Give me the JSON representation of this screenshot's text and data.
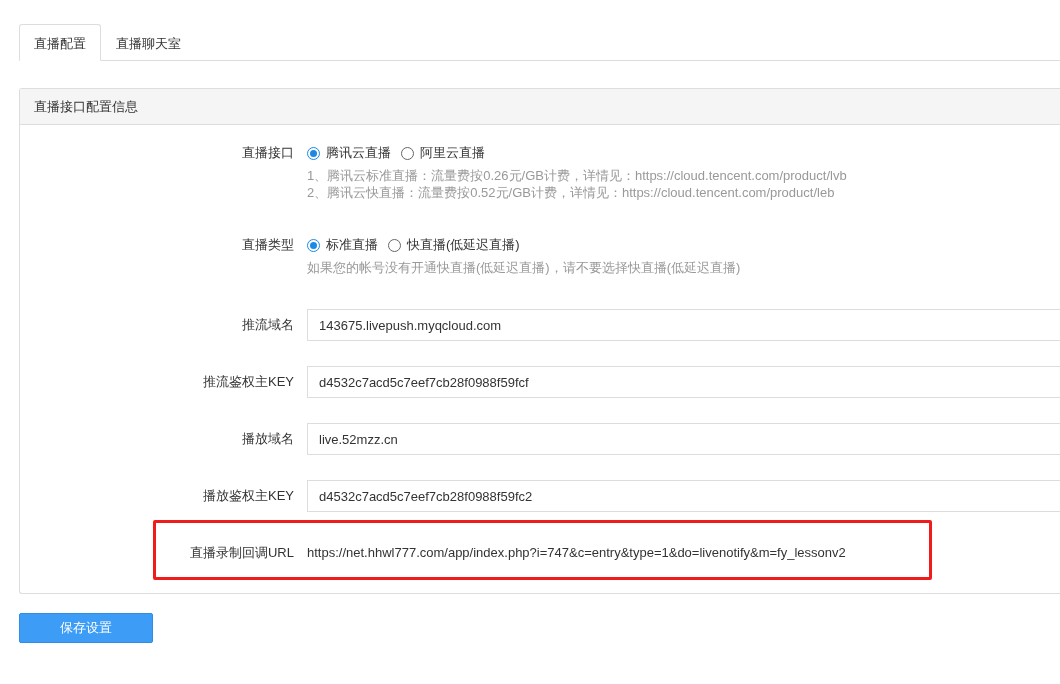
{
  "tabs": [
    {
      "label": "直播配置",
      "selected": true
    },
    {
      "label": "直播聊天室",
      "selected": false
    }
  ],
  "panel": {
    "title": "直播接口配置信息",
    "fields": [
      {
        "kind": "radio",
        "label": "直播接口",
        "options": [
          {
            "label": "腾讯云直播",
            "selected": true
          },
          {
            "label": "阿里云直播",
            "selected": false
          }
        ],
        "help": [
          "1、腾讯云标准直播：流量费按0.26元/GB计费，详情见：https://cloud.tencent.com/product/lvb",
          "2、腾讯云快直播：流量费按0.52元/GB计费，详情见：https://cloud.tencent.com/product/leb"
        ]
      },
      {
        "kind": "radio",
        "label": "直播类型",
        "options": [
          {
            "label": "标准直播",
            "selected": true
          },
          {
            "label": "快直播(低延迟直播)",
            "selected": false
          }
        ],
        "help": [
          "如果您的帐号没有开通快直播(低延迟直播)，请不要选择快直播(低延迟直播)"
        ]
      },
      {
        "kind": "input",
        "label": "推流域名",
        "value": "143675.livepush.myqcloud.com"
      },
      {
        "kind": "input",
        "label": "推流鉴权主KEY",
        "value": "d4532c7acd5c7eef7cb28f0988f59fcf"
      },
      {
        "kind": "input",
        "label": "播放域名",
        "value": "live.52mzz.cn"
      },
      {
        "kind": "input",
        "label": "播放鉴权主KEY",
        "value": "d4532c7acd5c7eef7cb28f0988f59fc2"
      },
      {
        "kind": "text",
        "label": "直播录制回调URL",
        "value": "https://net.hhwl777.com/app/index.php?i=747&c=entry&type=1&do=livenotify&m=fy_lessonv2",
        "highlighted": true
      }
    ]
  },
  "save_button": "保存设置"
}
